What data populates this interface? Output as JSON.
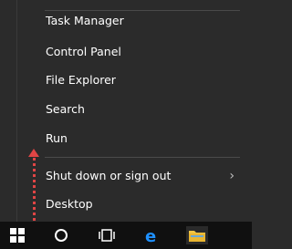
{
  "menu": {
    "items": [
      {
        "label": "Task Manager"
      },
      {
        "label": "Control Panel"
      },
      {
        "label": "File Explorer"
      },
      {
        "label": "Search"
      },
      {
        "label": "Run"
      },
      {
        "label": "Shut down or sign out"
      },
      {
        "label": "Desktop"
      }
    ]
  },
  "colors": {
    "menu_bg": "#2b2b2b",
    "taskbar_bg": "#101010",
    "arrow": "#e04545",
    "edge_blue": "#1e90ff",
    "explorer_yellow": "#f2c443"
  },
  "taskbar": {
    "icons": [
      "windows-start-icon",
      "search-circle-icon",
      "task-view-icon",
      "edge-browser-icon",
      "file-explorer-icon"
    ]
  }
}
